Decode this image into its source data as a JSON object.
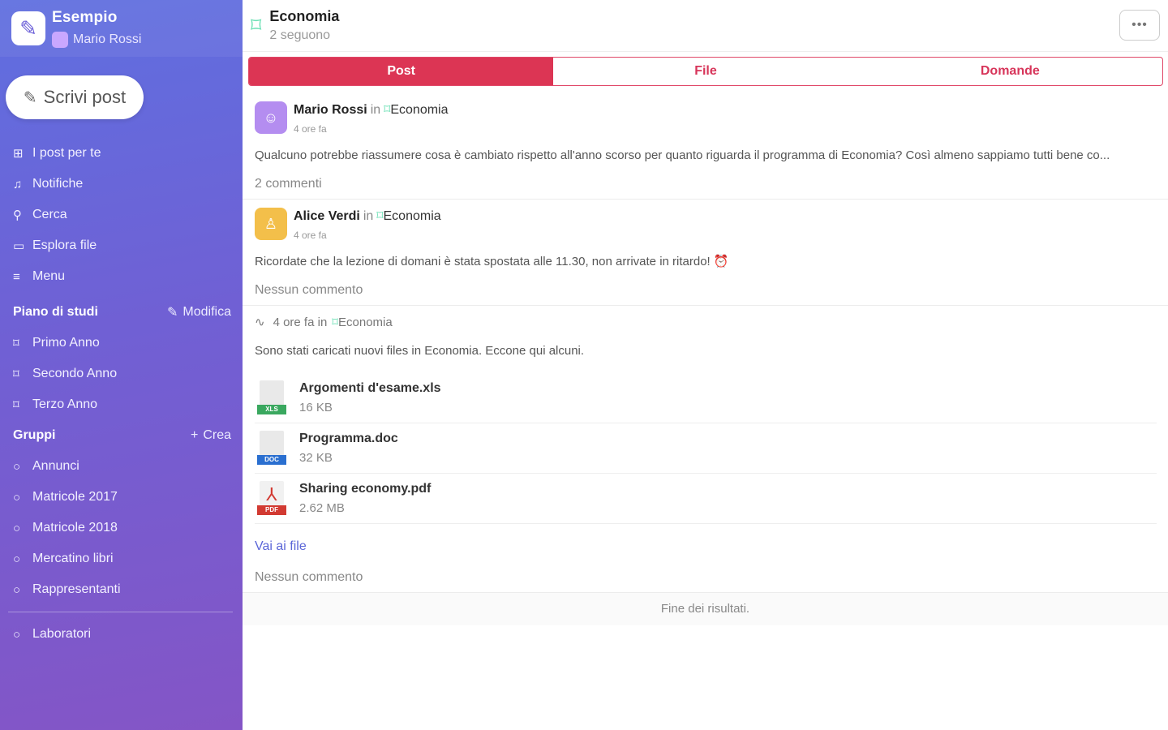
{
  "sidebar": {
    "brand": {
      "name": "Esempio",
      "user": "Mario Rossi"
    },
    "write_button": "Scrivi post",
    "nav": [
      {
        "label": "I post per te",
        "icon": "posts-icon"
      },
      {
        "label": "Notifiche",
        "icon": "bell-icon"
      },
      {
        "label": "Cerca",
        "icon": "search-icon"
      },
      {
        "label": "Esplora file",
        "icon": "folder-icon"
      },
      {
        "label": "Menu",
        "icon": "menu-icon"
      }
    ],
    "study_plan": {
      "title": "Piano di studi",
      "action": "Modifica",
      "items": [
        "Primo Anno",
        "Secondo Anno",
        "Terzo Anno"
      ]
    },
    "groups": {
      "title": "Gruppi",
      "action": "Crea",
      "items": [
        "Annunci",
        "Matricole 2017",
        "Matricole 2018",
        "Mercatino libri",
        "Rappresentanti"
      ]
    },
    "extra": [
      "Laboratori"
    ]
  },
  "header": {
    "title": "Economia",
    "subtitle": "2 seguono"
  },
  "tabs": [
    "Post",
    "File",
    "Domande"
  ],
  "posts": [
    {
      "author": "Mario Rossi",
      "in": "in",
      "group": "Economia",
      "time": "4 ore fa",
      "text": "Qualcuno potrebbe riassumere cosa è cambiato rispetto all'anno scorso per quanto riguarda il programma di Economia? Così almeno sappiamo tutti bene co...",
      "footer": "2 commenti"
    },
    {
      "author": "Alice Verdi",
      "in": "in",
      "group": "Economia",
      "time": "4 ore fa",
      "text": "Ricordate che la lezione di domani è stata spostata alle 11.30, non arrivate in ritardo!",
      "emoji": "⏰",
      "footer": "Nessun commento"
    }
  ],
  "activity": {
    "time": "4 ore fa in",
    "group": "Economia",
    "text": "Sono stati caricati nuovi files in Economia. Eccone qui alcuni.",
    "files": [
      {
        "name": "Argomenti d'esame.xls",
        "size": "16 KB",
        "type": "XLS",
        "color": "#3aa85f"
      },
      {
        "name": "Programma.doc",
        "size": "32 KB",
        "type": "DOC",
        "color": "#2a6fd0"
      },
      {
        "name": "Sharing economy.pdf",
        "size": "2.62 MB",
        "type": "PDF",
        "color": "#d23a32"
      }
    ],
    "link": "Vai ai file",
    "footer": "Nessun commento"
  },
  "end_text": "Fine dei risultati."
}
